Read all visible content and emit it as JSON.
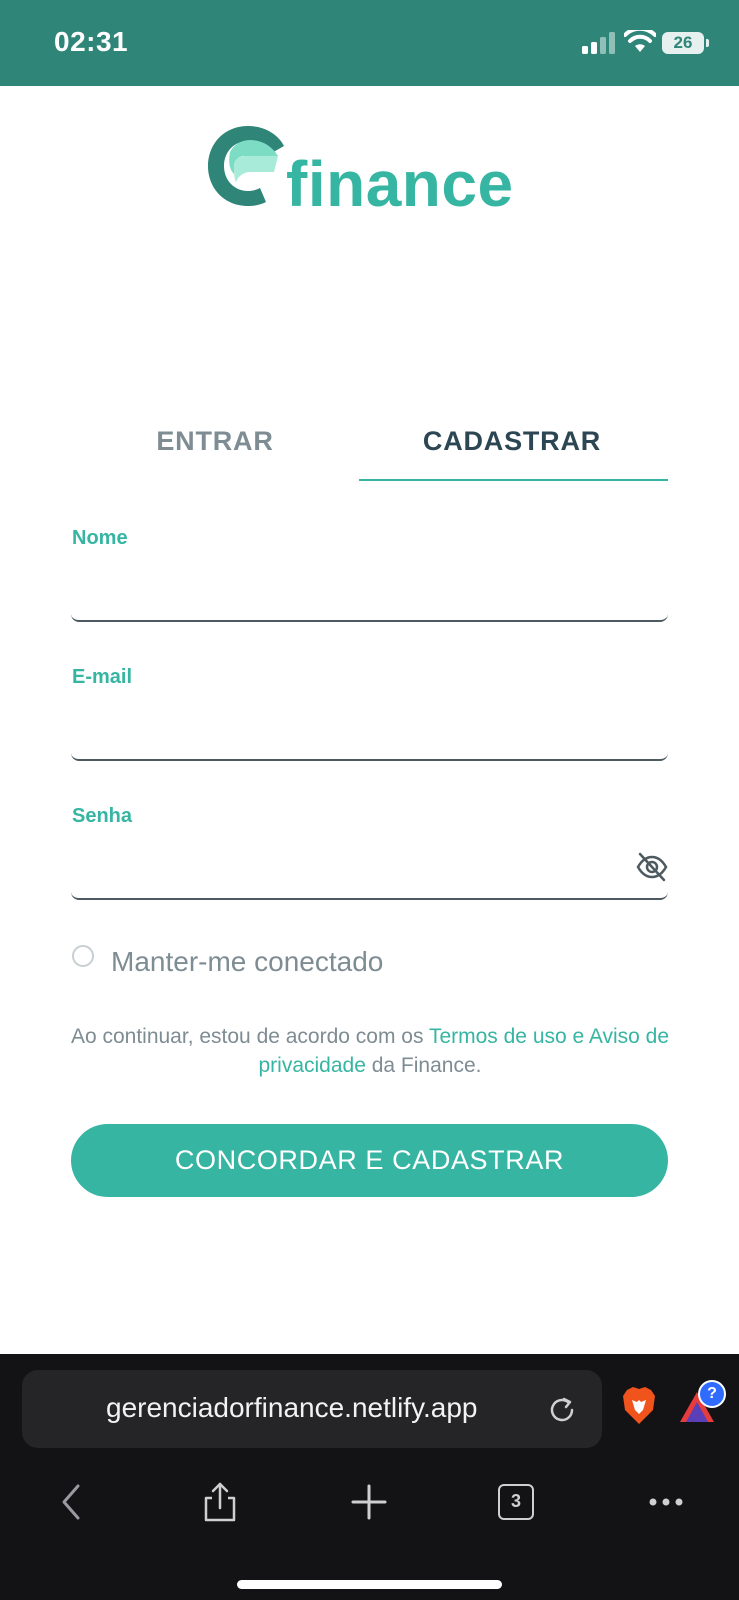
{
  "status_bar": {
    "time": "02:31",
    "battery": "26"
  },
  "logo": {
    "text": "finance"
  },
  "tabs": [
    {
      "label": "ENTRAR",
      "active": false
    },
    {
      "label": "CADASTRAR",
      "active": true
    }
  ],
  "form": {
    "name_label": "Nome",
    "email_label": "E-mail",
    "password_label": "Senha",
    "remember_label": "Manter-me conectado",
    "terms": {
      "prefix": "Ao continuar, estou de acordo com os ",
      "link": "Termos de uso e Aviso de privacidade",
      "suffix": " da Finance."
    },
    "submit_label": "CONCORDAR E CADASTRAR"
  },
  "browser": {
    "url": "gerenciadorfinance.netlify.app",
    "tab_count": "3",
    "extension_badge": "?"
  },
  "colors": {
    "accent": "#36b5a2",
    "status_bar": "#2e8578",
    "text_dark": "#2d4653",
    "text_muted": "#7e8c93"
  }
}
